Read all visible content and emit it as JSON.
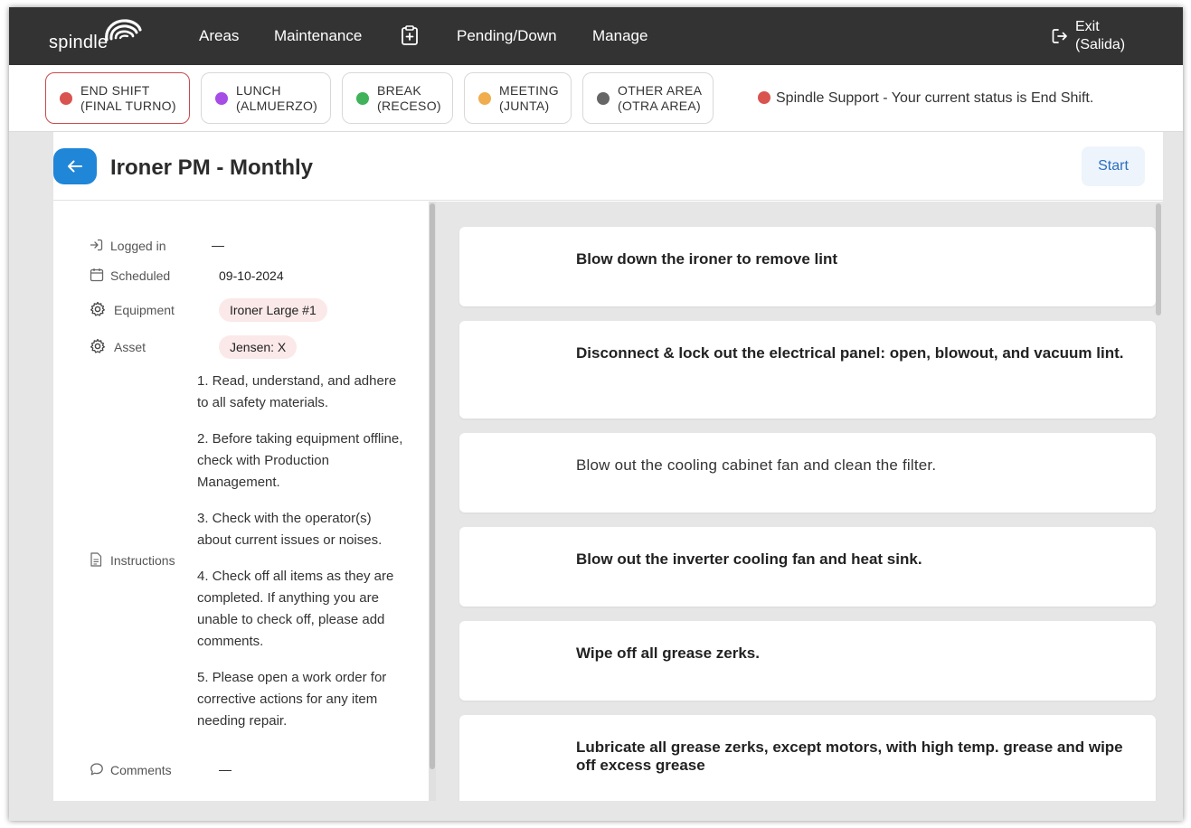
{
  "nav": {
    "logo_text": "spindle",
    "items": [
      "Areas",
      "Maintenance",
      "Pending/Down",
      "Manage"
    ],
    "clipboard_icon": "clipboard-plus-icon",
    "exit_line1": "Exit",
    "exit_line2": "(Salida)"
  },
  "status": {
    "buttons": [
      {
        "line1": "END SHIFT",
        "line2": "(FINAL TURNO)",
        "color": "#d9534f"
      },
      {
        "line1": "LUNCH",
        "line2": "(ALMUERZO)",
        "color": "#a64de6"
      },
      {
        "line1": "BREAK",
        "line2": "(RECESO)",
        "color": "#3fb25a"
      },
      {
        "line1": "MEETING",
        "line2": "(JUNTA)",
        "color": "#f0ad4e"
      },
      {
        "line1": "OTHER AREA",
        "line2": "(OTRA AREA)",
        "color": "#666666"
      }
    ],
    "support_text": "Spindle Support - Your current status is End Shift."
  },
  "page": {
    "title": "Ironer PM - Monthly",
    "start_label": "Start"
  },
  "details": {
    "logged_in_label": "Logged in",
    "logged_in_value": "—",
    "scheduled_label": "Scheduled",
    "scheduled_value": "09-10-2024",
    "equipment_label": "Equipment",
    "equipment_value": "Ironer Large #1",
    "asset_label": "Asset",
    "asset_value": "Jensen: X",
    "instructions_label": "Instructions",
    "instructions": [
      "1. Read, understand, and adhere to all safety materials.",
      "2. Before taking equipment offline, check with Production Management.",
      "3. Check with the operator(s) about current issues or noises.",
      "4. Check off all items as they are completed. If anything you are unable to check off, please add comments.",
      "5. Please open a work order for corrective actions for any item needing repair."
    ],
    "comments_label": "Comments",
    "comments_value": "—"
  },
  "tasks": [
    "Blow down the ironer to remove lint",
    "Disconnect & lock out the electrical panel: open, blowout, and vacuum lint.",
    "Blow out the cooling cabinet fan and clean the filter.",
    "Blow out the inverter cooling fan and heat sink.",
    "Wipe off all grease zerks.",
    "Lubricate all grease zerks, except motors, with high temp. grease and wipe off excess grease"
  ]
}
